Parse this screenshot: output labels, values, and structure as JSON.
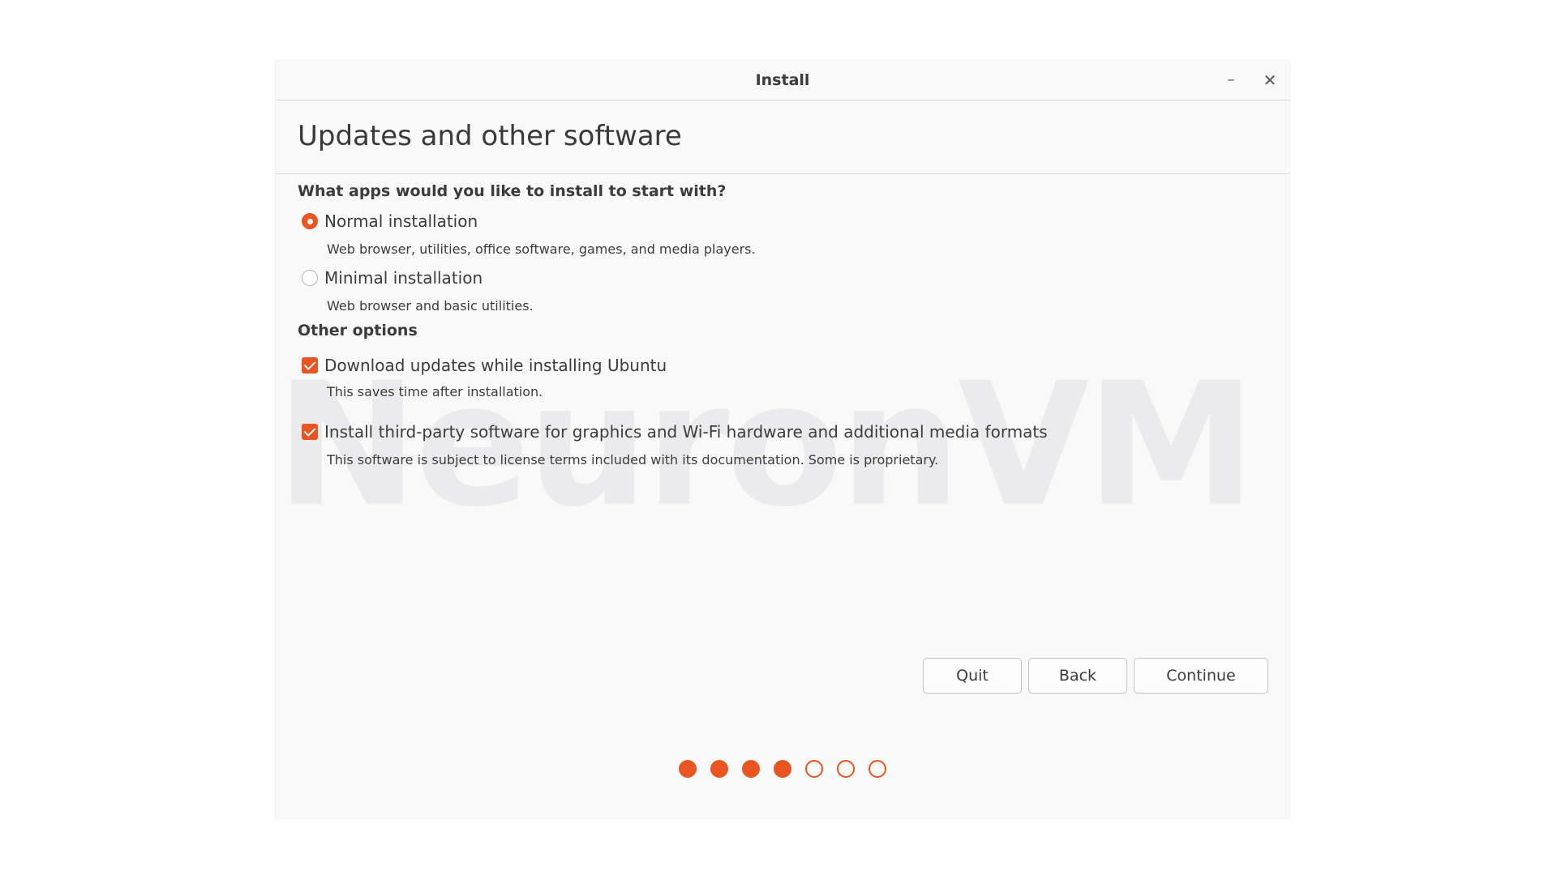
{
  "window": {
    "title": "Install",
    "minimize_glyph": "–",
    "close_glyph": "✕"
  },
  "page": {
    "title": "Updates and other software"
  },
  "apps_section": {
    "heading": "What apps would you like to install to start with?",
    "options": [
      {
        "label": "Normal installation",
        "description": "Web browser, utilities, office software, games, and media players.",
        "selected": true
      },
      {
        "label": "Minimal installation",
        "description": "Web browser and basic utilities.",
        "selected": false
      }
    ]
  },
  "other_section": {
    "heading": "Other options",
    "options": [
      {
        "label": "Download updates while installing Ubuntu",
        "description": "This saves time after installation.",
        "checked": true
      },
      {
        "label": "Install third-party software for graphics and Wi-Fi hardware and additional media formats",
        "description": "This software is subject to license terms included with its documentation. Some is proprietary.",
        "checked": true
      }
    ]
  },
  "watermark": "NeuronVM",
  "buttons": {
    "quit": "Quit",
    "back": "Back",
    "continue": "Continue"
  },
  "progress": {
    "total_steps": 7,
    "completed_steps": 4
  },
  "colors": {
    "accent": "#e95420",
    "window_bg": "#f9f9f9"
  }
}
